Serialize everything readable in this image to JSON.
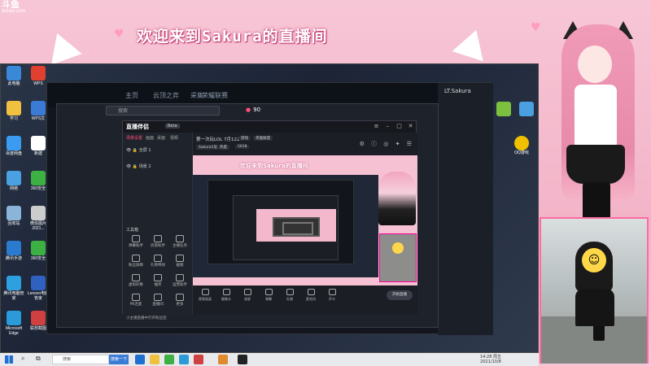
{
  "overlay": {
    "title": "欢迎来到Sakura的直播间",
    "logo_text": "斗鱼",
    "logo_sub": "douyu.com"
  },
  "desktop_icons": [
    {
      "label": "此电脑",
      "color": "#3a88d8"
    },
    {
      "label": "WPS",
      "color": "#e04030"
    },
    {
      "label": "学习",
      "color": "#f0c040"
    },
    {
      "label": "WPS文",
      "color": "#3a7bd5"
    },
    {
      "label": "百度网盘",
      "color": "#3a9bf0"
    },
    {
      "label": "新建",
      "color": "#ffffff"
    },
    {
      "label": "网络",
      "color": "#4aa0e0"
    },
    {
      "label": "360安全",
      "color": "#3cb043"
    },
    {
      "label": "回收站",
      "color": "#8ab4d8"
    },
    {
      "label": "微信图片 2021...",
      "color": "#cccccc"
    },
    {
      "label": "腾讯手游",
      "color": "#2a7ad0"
    },
    {
      "label": "360安全",
      "color": "#3cb043"
    },
    {
      "label": "腾讯电脑管家",
      "color": "#2ea0e0"
    },
    {
      "label": "Lenovo电脑管家",
      "color": "#3060c0"
    },
    {
      "label": "Microsoft Edge",
      "color": "#2a9ad8"
    },
    {
      "label": "联想截图",
      "color": "#d04040"
    }
  ],
  "right_desktop_icons": [
    {
      "label": "",
      "color": "#7cc040"
    },
    {
      "label": "",
      "color": "#4aa0e0"
    },
    {
      "label": "QQ游戏",
      "color": "#f0c000"
    }
  ],
  "game_client": {
    "tabs": [
      "主页",
      "云顶之弈",
      "采集",
      "荣耀联赛"
    ],
    "search_placeholder": "搜索",
    "currency": "90",
    "friend_name": "LT.Sakura"
  },
  "stream_app": {
    "logo": "直播伴侣",
    "version": "Beta",
    "scene_tabs": [
      "场景设置",
      "画面",
      "桌面",
      "视频"
    ],
    "scene_rows": [
      "全屏 1",
      "场景 2"
    ],
    "tools_label": "工具箱",
    "tools": [
      "弹幕助手",
      "房管助手",
      "主播任务",
      "粉丝勋章",
      "礼物特效",
      "截图",
      "虚拟形象",
      "抽奖",
      "运营助手",
      "PK连麦",
      "直播间",
      "更多"
    ],
    "bottom_note": "小主播直播中打开粉丝团",
    "room_title": "第一次玩LOL 7月1227",
    "room_chips": [
      "游戏",
      "英雄联盟",
      "Sakura1号",
      "热度",
      "5618"
    ],
    "toolbar": [
      "视频画面",
      "摄像头",
      "录屏",
      "弹幕",
      "礼物",
      "麦克风",
      "声卡"
    ],
    "go_live": "开始直播"
  },
  "taskbar": {
    "search": "搜索",
    "btn": "搜索一下",
    "time": "14:28 周五",
    "date": "2021/10/8"
  }
}
